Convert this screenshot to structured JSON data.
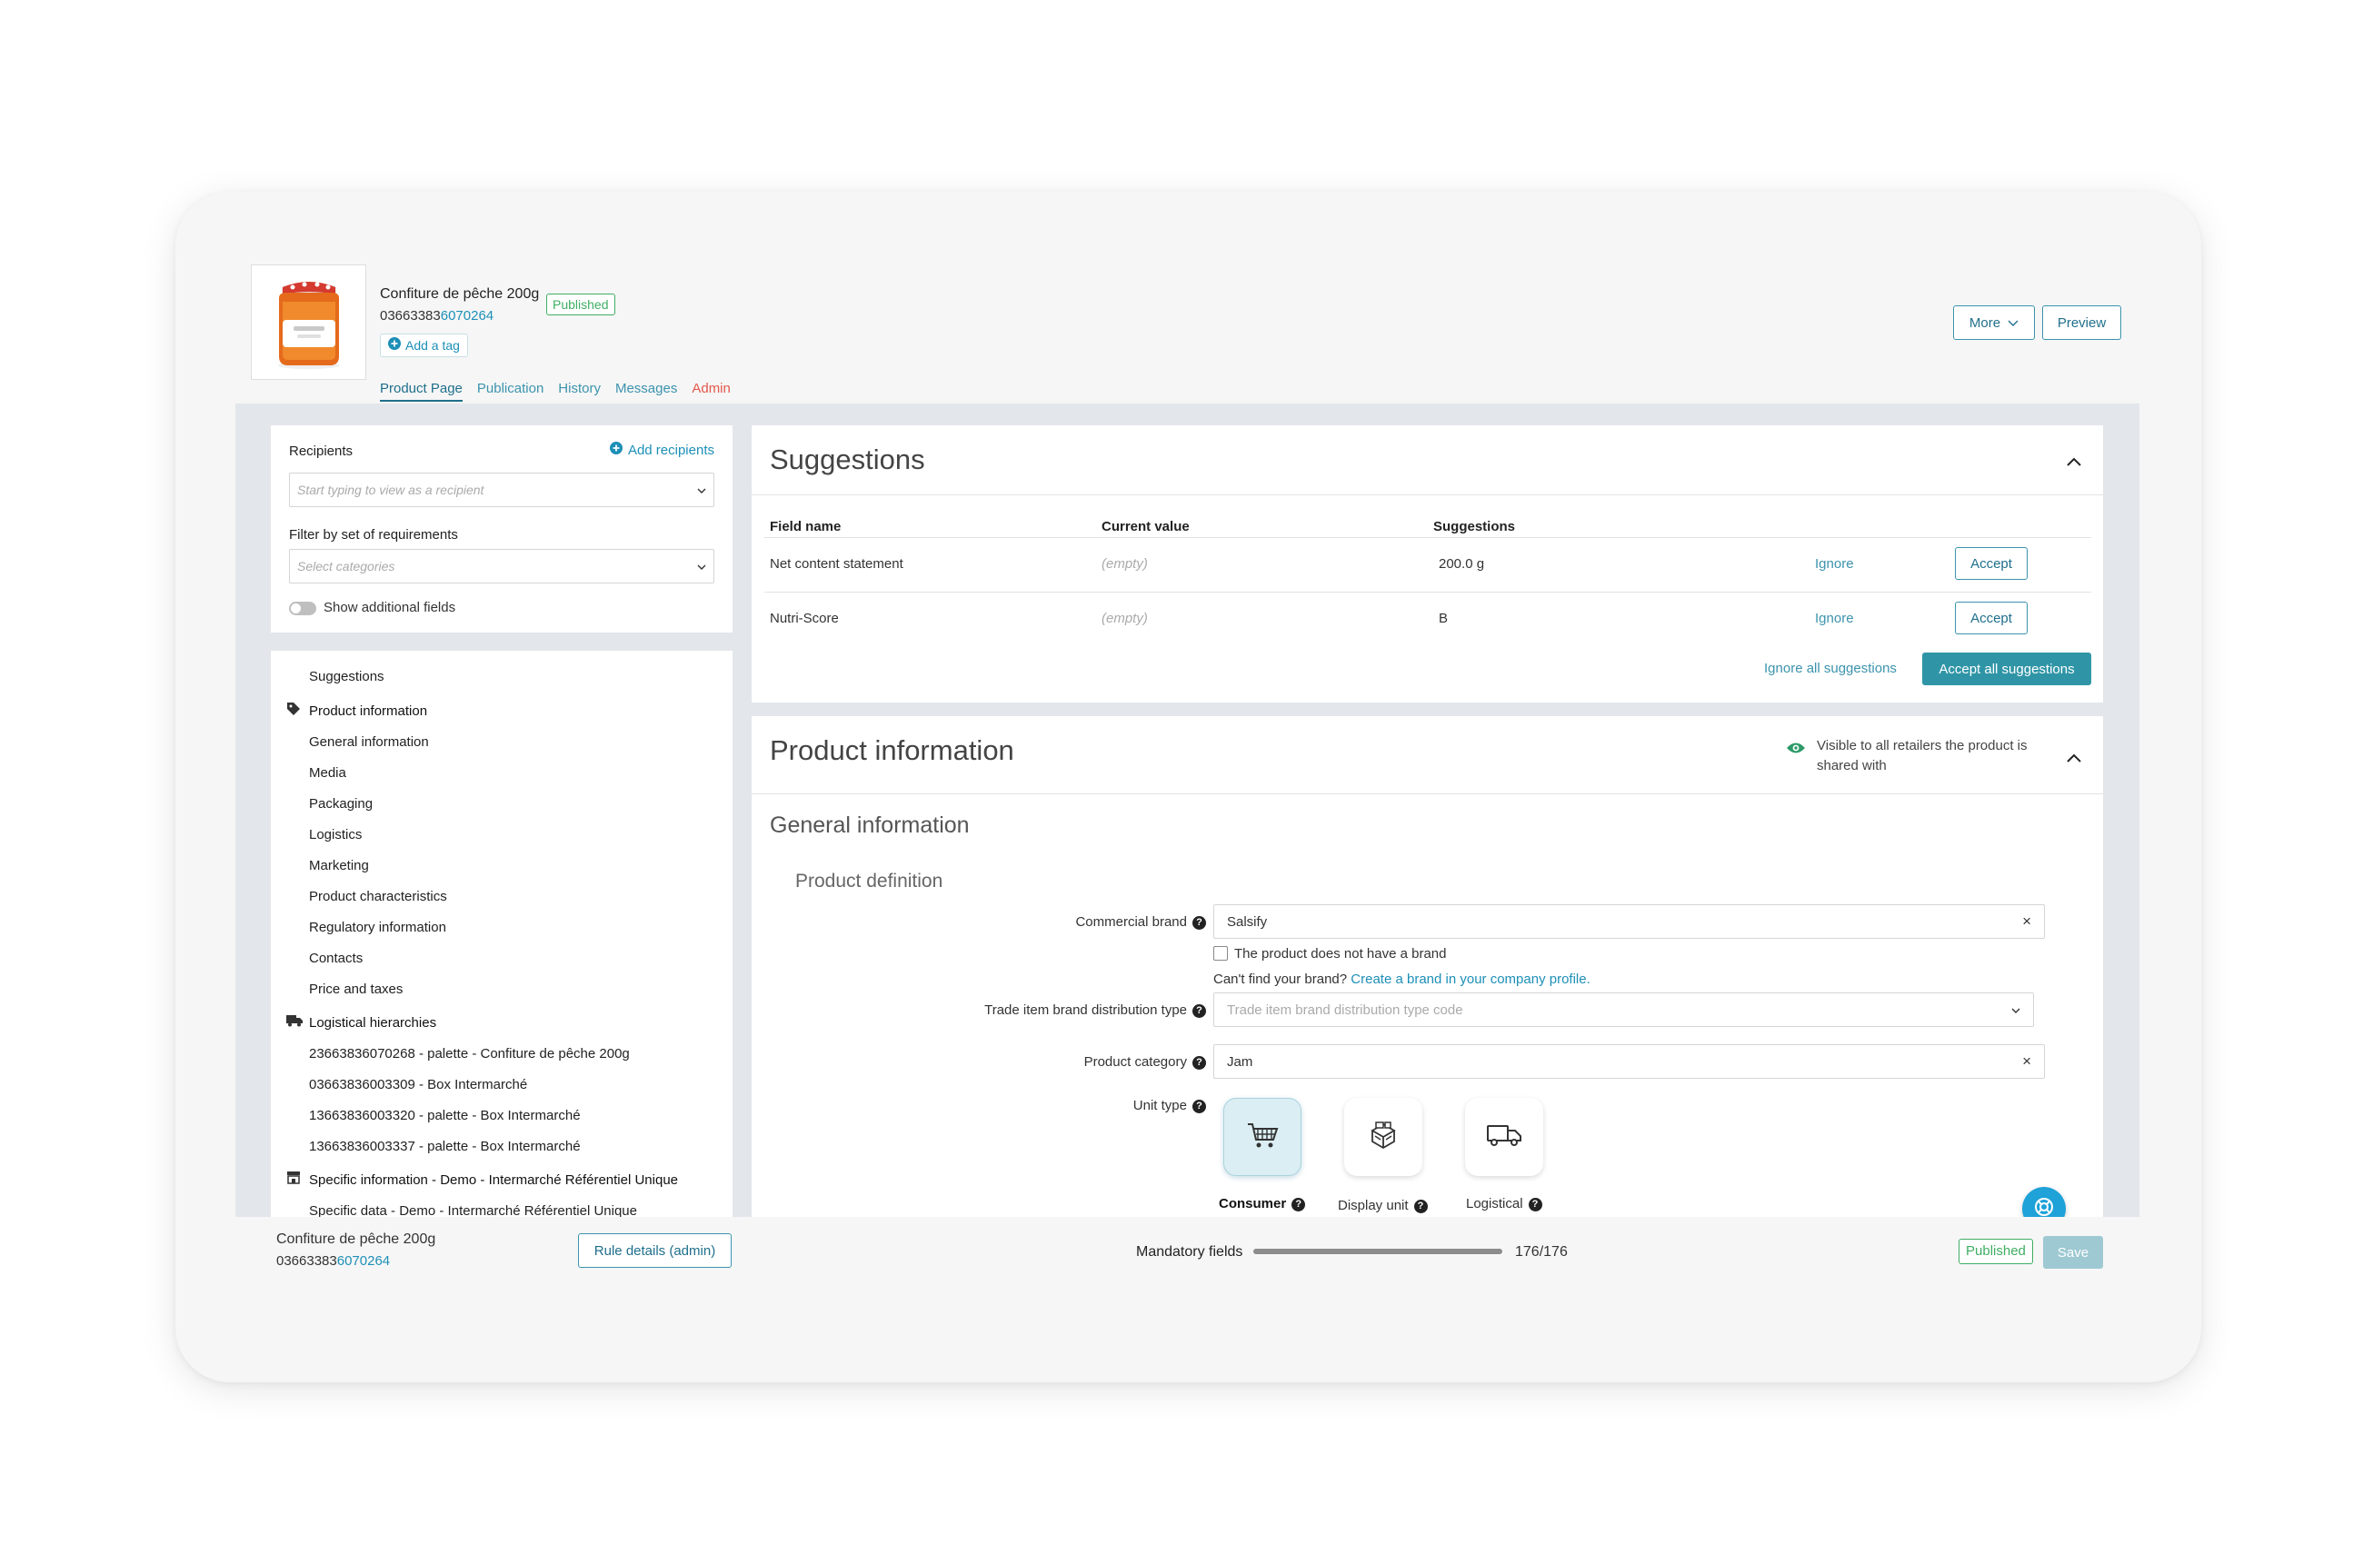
{
  "product": {
    "name": "Confiture de pêche 200g",
    "gtin_prefix": "03663383",
    "gtin_suffix": "6070264",
    "status_badge": "Published",
    "add_tag": "Add a tag"
  },
  "tabs": [
    {
      "label": "Product Page",
      "active": true
    },
    {
      "label": "Publication"
    },
    {
      "label": "History"
    },
    {
      "label": "Messages"
    },
    {
      "label": "Admin"
    }
  ],
  "header_buttons": {
    "more": "More",
    "preview": "Preview"
  },
  "filters": {
    "recipients_label": "Recipients",
    "add_recipients": "Add recipients",
    "recipient_placeholder": "Start typing to view as a recipient",
    "requirements_label": "Filter by set of requirements",
    "categories_placeholder": "Select categories",
    "show_additional": "Show additional fields"
  },
  "nav": {
    "suggestions": "Suggestions",
    "product_information": "Product information",
    "product_items": [
      "General information",
      "Media",
      "Packaging",
      "Logistics",
      "Marketing",
      "Product characteristics",
      "Regulatory information",
      "Contacts",
      "Price and taxes"
    ],
    "logistical_hierarchies": "Logistical hierarchies",
    "hierarchy_items": [
      "23663836070268 - palette - Confiture de pêche 200g",
      "03663836003309 - Box Intermarché",
      "13663836003320 - palette - Box Intermarché",
      "13663836003337 - palette - Box Intermarché"
    ],
    "specific_information": "Specific information - Demo - Intermarché Référentiel Unique",
    "specific_items": [
      "Specific data - Demo - Intermarché Référentiel Unique"
    ]
  },
  "suggestions": {
    "title": "Suggestions",
    "columns": {
      "field": "Field name",
      "current": "Current value",
      "suggestion": "Suggestions"
    },
    "rows": [
      {
        "field": "Net content statement",
        "current": "(empty)",
        "suggestion": "200.0 g",
        "ignore": "Ignore",
        "accept": "Accept"
      },
      {
        "field": "Nutri-Score",
        "current": "(empty)",
        "suggestion": "B",
        "ignore": "Ignore",
        "accept": "Accept"
      }
    ],
    "ignore_all": "Ignore all suggestions",
    "accept_all": "Accept all suggestions"
  },
  "product_info": {
    "title": "Product information",
    "visibility": "Visible to all retailers the product is shared with",
    "section": "General information",
    "subsection": "Product definition",
    "commercial_brand_label": "Commercial brand",
    "commercial_brand_value": "Salsify",
    "no_brand_checkbox": "The product does not have a brand",
    "cant_find_prefix": "Can't find your brand?",
    "create_brand_link": "Create a brand in your company profile.",
    "trade_item_label": "Trade item brand distribution type",
    "trade_item_placeholder": "Trade item brand distribution type code",
    "product_category_label": "Product category",
    "product_category_value": "Jam",
    "unit_type_label": "Unit type",
    "unit_types": [
      "Consumer",
      "Display unit",
      "Logistical"
    ]
  },
  "footer": {
    "name": "Confiture de pêche 200g",
    "gtin_prefix": "03663383",
    "gtin_suffix": "6070264",
    "rule_details": "Rule details (admin)",
    "mandatory_label": "Mandatory fields",
    "mandatory_value": "176/176",
    "mandatory_fraction": 1.0,
    "status_badge": "Published",
    "save": "Save"
  },
  "colors": {
    "accent": "#2f95a6",
    "link": "#1d8fb7",
    "published": "#3fae63",
    "admin": "#e4584a"
  }
}
